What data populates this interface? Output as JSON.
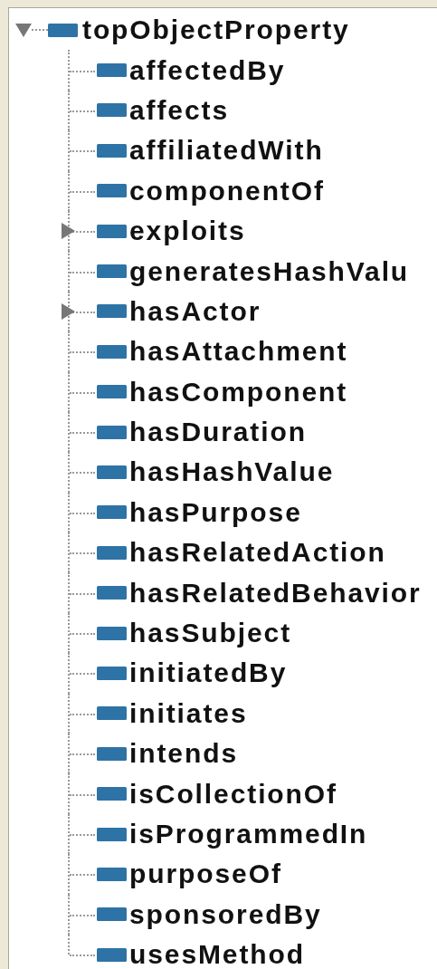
{
  "tree": {
    "label": "topObjectProperty",
    "expanded": true,
    "children": [
      {
        "label": "affectedBy"
      },
      {
        "label": "affects"
      },
      {
        "label": "affiliatedWith"
      },
      {
        "label": "componentOf"
      },
      {
        "label": "exploits",
        "expanded": false
      },
      {
        "label": "generatesHashValu"
      },
      {
        "label": "hasActor",
        "expanded": false
      },
      {
        "label": "hasAttachment"
      },
      {
        "label": "hasComponent"
      },
      {
        "label": "hasDuration"
      },
      {
        "label": "hasHashValue"
      },
      {
        "label": "hasPurpose"
      },
      {
        "label": "hasRelatedAction"
      },
      {
        "label": "hasRelatedBehavior"
      },
      {
        "label": "hasSubject"
      },
      {
        "label": "initiatedBy"
      },
      {
        "label": "initiates"
      },
      {
        "label": "intends"
      },
      {
        "label": "isCollectionOf"
      },
      {
        "label": "isProgrammedIn"
      },
      {
        "label": "purposeOf"
      },
      {
        "label": "sponsoredBy"
      },
      {
        "label": "usesMethod"
      }
    ]
  }
}
